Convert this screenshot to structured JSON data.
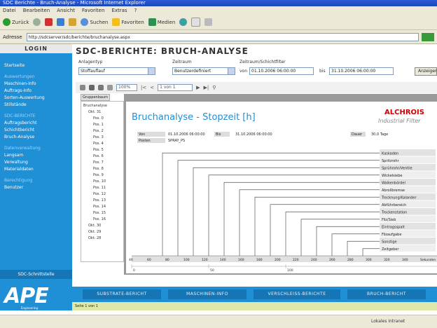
{
  "browser": {
    "title": "SDC Berichte - Bruch-Analyse - Microsoft Internet Explorer",
    "menu": [
      "Datei",
      "Bearbeiten",
      "Ansicht",
      "Favoriten",
      "Extras",
      "?"
    ],
    "toolbar": {
      "back": "Zurück",
      "search": "Suchen",
      "favorites": "Favoriten",
      "media": "Medien"
    },
    "address_label": "Adresse",
    "address_value": "http://sdcserver/sdc/berichte/bruchanalyse.aspx",
    "status_zone": "Lokales Intranet"
  },
  "sidebar": {
    "header": "LOGIN",
    "items": [
      {
        "label": "Startseite",
        "group": false
      },
      {
        "label": "Auswertungen",
        "group": true
      },
      {
        "label": "Maschinen-Info",
        "group": false
      },
      {
        "label": "Auftrags-Info",
        "group": false
      },
      {
        "label": "Sorten-Auswertung",
        "group": false
      },
      {
        "label": "Stillstände",
        "group": false
      },
      {
        "label": "SDC-BERICHTE",
        "group": true
      },
      {
        "label": "Auftragsbericht",
        "group": false
      },
      {
        "label": "Schichtbericht",
        "group": false
      },
      {
        "label": "Bruch-Analyse",
        "group": false
      },
      {
        "label": "Datenverwaltung",
        "group": true
      },
      {
        "label": "Langsam",
        "group": false
      },
      {
        "label": "Verwaltung",
        "group": false
      },
      {
        "label": "Materialdaten",
        "group": false
      },
      {
        "label": "Berechtigung",
        "group": true
      },
      {
        "label": "Benutzer",
        "group": false
      }
    ],
    "footer": "SDC-Schnittstelle",
    "logo": "APE",
    "logo_sub": "Engineering"
  },
  "main": {
    "title": "SDC-BERICHTE: BRUCH-ANALYSE",
    "filters": {
      "machine_label": "Anlagentyp",
      "machine_value": "Stoffauflauf",
      "period_label": "Zeitraum",
      "period_value": "Benutzerdefiniert",
      "range_label": "Zeitraum/Schichtfilter",
      "from_label": "von",
      "from_value": "01.10.2006 06:00:00",
      "to_label": "bis",
      "to_value": "31.10.2006 06:00:00",
      "show_button": "Anzeigen"
    },
    "report_toolbar": {
      "page_of": "1 von 1",
      "zoom": "100%"
    }
  },
  "tree": {
    "tab": "Gruppenbaum",
    "items": [
      {
        "label": "Bruchanalyse",
        "indent": 0
      },
      {
        "label": "Okt. 31",
        "indent": 1
      },
      {
        "label": "Pos. 0",
        "indent": 2
      },
      {
        "label": "Pos. 1",
        "indent": 2
      },
      {
        "label": "Pos. 2",
        "indent": 2
      },
      {
        "label": "Pos. 3",
        "indent": 2
      },
      {
        "label": "Pos. 4",
        "indent": 2
      },
      {
        "label": "Pos. 5",
        "indent": 2
      },
      {
        "label": "Pos. 6",
        "indent": 2
      },
      {
        "label": "Pos. 7",
        "indent": 2
      },
      {
        "label": "Pos. 8",
        "indent": 2
      },
      {
        "label": "Pos. 9",
        "indent": 2
      },
      {
        "label": "Pos. 10",
        "indent": 2
      },
      {
        "label": "Pos. 11",
        "indent": 2
      },
      {
        "label": "Pos. 12",
        "indent": 2
      },
      {
        "label": "Pos. 13",
        "indent": 2
      },
      {
        "label": "Pos. 14",
        "indent": 2
      },
      {
        "label": "Pos. 15",
        "indent": 2
      },
      {
        "label": "Pos. 16",
        "indent": 2
      },
      {
        "label": "Okt. 30",
        "indent": 1
      },
      {
        "label": "Okt. 29",
        "indent": 1
      },
      {
        "label": "Okt. 28",
        "indent": 1
      }
    ]
  },
  "report": {
    "title": "Bruchanalyse - Stopzeit [h]",
    "brand_line1": "ALCHROIS",
    "brand_line2": "Industrial Filter",
    "info": {
      "von_label": "Von",
      "von_value": "01.10.2006 06:00:00",
      "bis_label": "Bis",
      "bis_value": "31.10.2006 06:00:00",
      "days_label": "Dauer",
      "days_value": "30,0 Tage",
      "posten_label": "Posten",
      "posten_value": "SPRAY_PS"
    },
    "categories": [
      "Kaskaden",
      "Spritzrohr",
      "Sprührohr/Ventile",
      "Wickelsiebe",
      "Walkenbördel",
      "Abrollbremse",
      "Trocknung/Kalander",
      "Abführbereich",
      "Trockenstation",
      "Filz/Sieb",
      "Eintragsspalt",
      "Filzaufgabe",
      "Sonstige",
      "Zeitgeber"
    ],
    "axis_label": "Sekunden",
    "ticks": [
      "40",
      "60",
      "80",
      "100",
      "120",
      "140",
      "160",
      "180",
      "200",
      "220",
      "240",
      "260",
      "280",
      "300",
      "320",
      "340",
      "Sekunden"
    ],
    "scale_marks": [
      "0",
      "50",
      "100"
    ]
  },
  "tabs": [
    "SUBSTRATE-BERICHT",
    "MASCHINEN-INFO",
    "VERSCHLEISS-BERICHTE",
    "BRUCH-BERICHT"
  ],
  "status_line": "Seite 1 von 1"
}
